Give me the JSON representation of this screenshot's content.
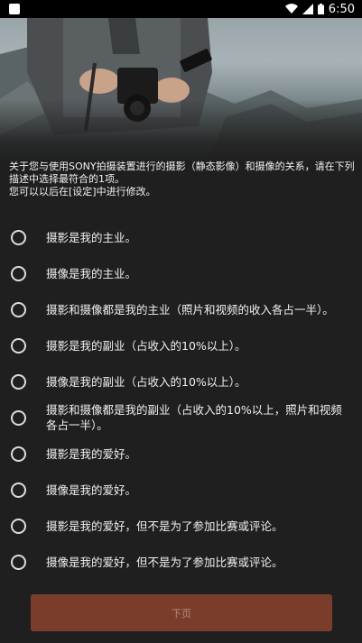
{
  "status_bar": {
    "time": "6:50"
  },
  "intro": {
    "line1": "关于您与使用SONY拍摄装置进行的摄影（静态影像）和摄像的关系，请在下列描述中选择最符合的1项。",
    "line2": "您可以以后在[设定]中进行修改。"
  },
  "options": [
    "摄影是我的主业。",
    "摄像是我的主业。",
    "摄影和摄像都是我的主业（照片和视频的收入各占一半）。",
    "摄影是我的副业（占收入的10%以上）。",
    "摄像是我的副业（占收入的10%以上）。",
    "摄影和摄像都是我的副业（占收入的10%以上，照片和视频各占一半）。",
    "摄影是我的爱好。",
    "摄像是我的爱好。",
    "摄影是我的爱好，但不是为了参加比赛或评论。",
    "摄像是我的爱好，但不是为了参加比赛或评论。"
  ],
  "next_button": {
    "label": "下页"
  },
  "colors": {
    "background": "#1f1f1f",
    "button": "#7a3d2b"
  }
}
